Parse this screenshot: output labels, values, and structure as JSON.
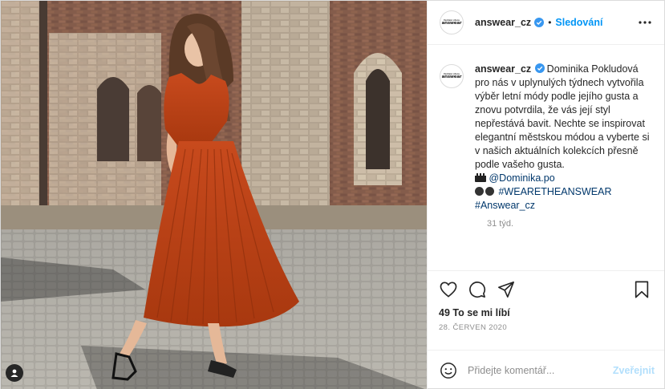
{
  "post": {
    "username": "answear_cz",
    "follow_label": "Sledování",
    "avatar_brand_top": "fashion store",
    "avatar_brand": "answear"
  },
  "caption": {
    "username": "answear_cz",
    "text": "Dominika Pokludová pro nás v uplynulých týdnech vytvořila výběr letní módy podle jejího gusta a znovu potvrdila, že vás její styl nepřestává bavit. Nechte se inspirovat elegantní městskou módou a vyberte si v našich aktuálních kolekcích přesně podle vašeho gusta.",
    "mention": "@Dominika.po",
    "hashtag_1": "#WEARETHEANSWEAR",
    "hashtag_2": "#Answear_cz",
    "time_ago": "31 týd."
  },
  "actions": {
    "likes": "49 To se mi líbí",
    "date": "28. ČERVEN 2020"
  },
  "comment": {
    "placeholder": "Přidejte komentář...",
    "post_label": "Zveřejnit"
  },
  "icons": {
    "verified": "verified-badge-icon",
    "more": "more-options-icon",
    "like": "heart-icon",
    "comment": "comment-icon",
    "share": "share-icon",
    "save": "bookmark-icon",
    "emoji": "emoji-icon",
    "tag": "user-tag-icon"
  },
  "colors": {
    "accent": "#0095f6",
    "link": "#00376b",
    "muted": "#8e8e8e",
    "dress": "#c8471c"
  }
}
